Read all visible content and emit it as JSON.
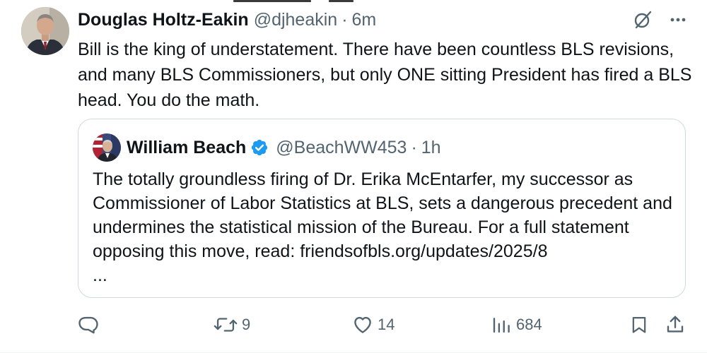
{
  "tweet": {
    "author_name": "Douglas Holtz-Eakin",
    "author_handle": "@djheakin",
    "separator": "·",
    "time": "6m",
    "text": "Bill is the king of understatement. There have been countless BLS revisions, and many BLS Commissioners, but only ONE sitting President has fired a BLS head. You do the math."
  },
  "quoted_tweet": {
    "author_name": "William Beach",
    "author_handle": "@BeachWW453",
    "separator": "·",
    "time": "1h",
    "text": "The totally groundless firing of Dr. Erika McEntarfer, my successor as Commissioner of Labor Statistics at BLS, sets a dangerous precedent and undermines the statistical mission of the Bureau.  For a full statement opposing this move, read: friendsofbls.org/updates/2025/8",
    "ellipsis": "..."
  },
  "header_icons": [
    "grok-icon",
    "more-icon"
  ],
  "actions": {
    "reply_icon": "reply-icon",
    "retweet_icon": "retweet-icon",
    "retweet_count": "9",
    "like_icon": "heart-icon",
    "like_count": "14",
    "views_icon": "views-icon",
    "views_count": "684",
    "bookmark_icon": "bookmark-icon",
    "share_icon": "share-icon"
  },
  "colors": {
    "text": "#0f1419",
    "secondary": "#536471",
    "verified_blue": "#1d9bf0",
    "border": "#cfd9de"
  }
}
